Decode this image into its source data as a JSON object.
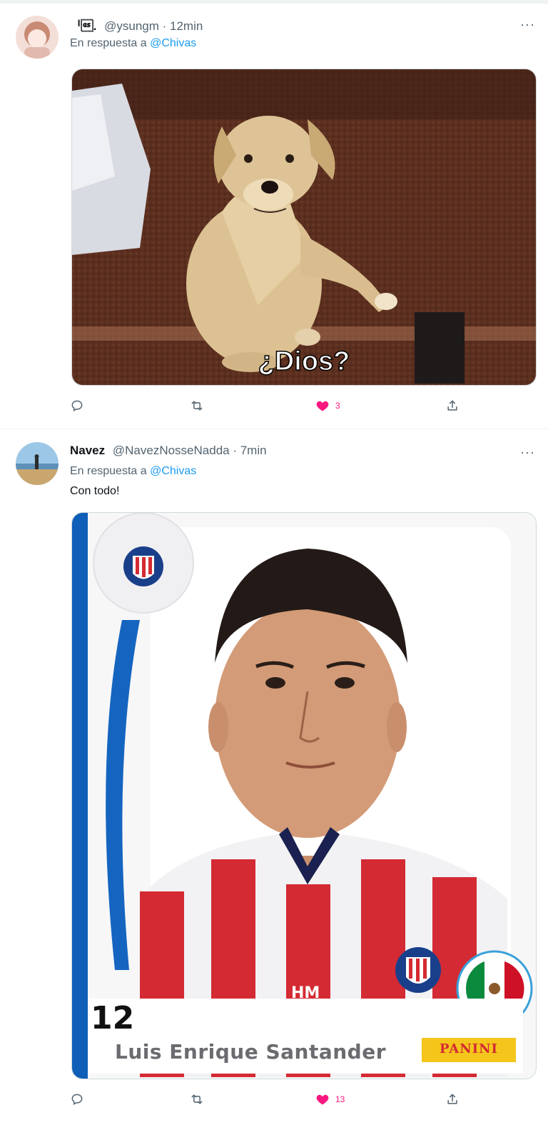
{
  "tweets": [
    {
      "display_name": "ᅵ\u001d.",
      "handle": "@ysungm",
      "time": "· 12min",
      "reply_prefix": "En respuesta a",
      "reply_to": "@Chivas",
      "text": "",
      "media_caption": "¿Dios?",
      "likes": "3"
    },
    {
      "display_name": "Navez",
      "handle": "@NavezNosseNadda",
      "time": "· 7min",
      "reply_prefix": "En respuesta a",
      "reply_to": "@Chivas",
      "text": "Con todo!",
      "card": {
        "number": "12",
        "player_name": "Luis Enrique Santander",
        "brand": "PANINI",
        "jersey_sponsor": "HM"
      },
      "likes": "13"
    }
  ],
  "more_label": "···",
  "colors": {
    "accent": "#1d9bf0",
    "like": "#f91880",
    "muted": "#536471"
  }
}
